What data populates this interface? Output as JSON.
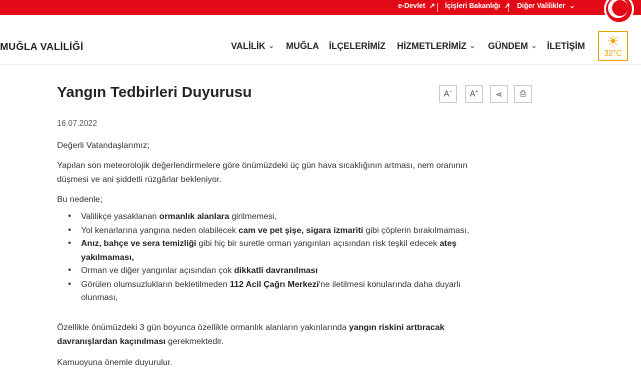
{
  "topbar": {
    "links": [
      "e-Devlet",
      "İçişleri Bakanlığı",
      "Diğer Valilikler"
    ],
    "ext_icon": "↗",
    "dropdown_icon": "⌄"
  },
  "header": {
    "logo_text": "MUĞLA VALİLİĞİ",
    "nav": [
      {
        "label": "VALİLİK",
        "chevron": "⌄"
      },
      {
        "label": "MUĞLA",
        "chevron": ""
      },
      {
        "label": "İLÇELERİMİZ",
        "chevron": ""
      },
      {
        "label": "HİZMETLERİMİZ",
        "chevron": "⌄"
      },
      {
        "label": "GÜNDEM",
        "chevron": "⌄"
      },
      {
        "label": "İLETİŞİM",
        "chevron": ""
      }
    ],
    "weather": {
      "icon": "☀",
      "temp": "32°C"
    }
  },
  "article": {
    "title": "Yangın Tedbirleri Duyurusu",
    "tools": {
      "font_decrease": "A",
      "font_decrease_sup": "−",
      "font_increase": "A",
      "font_increase_sup": "+",
      "share": "⋖",
      "print": "⎙"
    },
    "date": "16.07.2022",
    "greeting": "Değerli Vatandaşlarımız;",
    "intro_1": "Yapılan son meteorolojik değerlendirmelere göre önümüzdeki üç gün hava sıcaklığının artması, nem oranının",
    "intro_2": "düşmesi ve ani şiddetli rüzgârlar bekleniyor.",
    "bu_nedenle": "Bu nedenle;",
    "items": [
      {
        "a": "Valilikçe yasaklanan ",
        "b": "ormanlık alanlara",
        "c": " girilmemesi,"
      },
      {
        "a": "Yol kenarlarına yangına neden olabilecek ",
        "b": "cam ve pet şişe, sigara izmariti",
        "c": " gibi çöplerin bırakılmaması,"
      },
      {
        "a": "",
        "b": "Anız, bahçe ve sera temizliği",
        "c": " gibi hiç bir suretle orman yangınları açısından risk teşkil edecek ",
        "d": "ateş",
        "e": "yakılmaması,"
      },
      {
        "a": "Orman ve diğer yangınlar açısından çok ",
        "b": "dikkatli davranılması",
        "c": ""
      },
      {
        "a": "Görülen olumsuzlukların bekletilmeden ",
        "b": "112 Acil Çağrı Merkezi",
        "c": "'ne iletilmesi konularında daha duyarlı",
        "e": "olunması,"
      }
    ],
    "closing_1a": "Özellikle önümüzdeki 3 gün boyunca özellikle ormanlık alanların yakınlarında ",
    "closing_1b": "yangın riskini arttıracak",
    "closing_2a": "davranışlardan kaçınılması",
    "closing_2b": " gerekmektedir.",
    "final": "Kamuoyuna önemle duyurulur."
  }
}
